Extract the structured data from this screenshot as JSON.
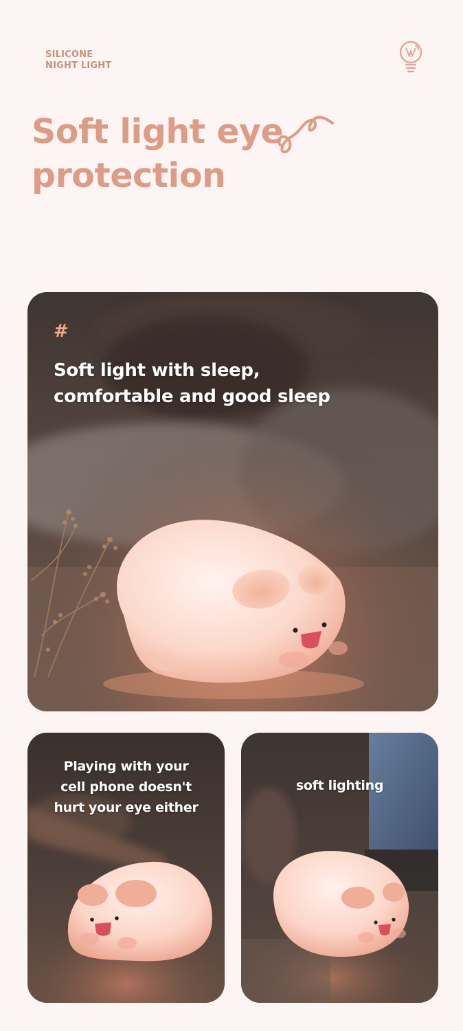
{
  "brand": {
    "line1": "SILICONE",
    "line2": "NIGHT LIGHT"
  },
  "icons": {
    "top_right": "lightbulb-icon",
    "headline_decoration": "squiggle-decoration"
  },
  "headline": {
    "line1": "Soft light eye",
    "line2": "protection"
  },
  "main_card": {
    "marker": "#",
    "line1": "Soft light with sleep,",
    "line2": "comfortable and good sleep"
  },
  "left_card": {
    "line1": "Playing with your",
    "line2": "cell phone doesn't",
    "line3": "hurt your eye either"
  },
  "right_card": {
    "caption": "soft lighting"
  },
  "colors": {
    "background": "#fcf5f4",
    "accent": "#dd9c86",
    "brand_text": "#c8907c",
    "caption_text": "#ffffff",
    "lamp": "#fde3da",
    "pig_nose": "#d94f5c"
  }
}
